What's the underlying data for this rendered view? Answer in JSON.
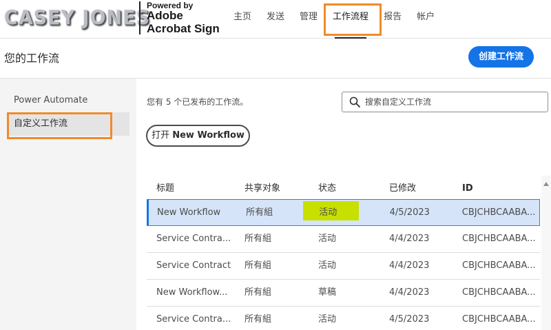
{
  "brand": {
    "logo_text": "CASEY JONES",
    "powered_by": "Powered by",
    "product_line1": "Adobe",
    "product_line2": "Acrobat Sign"
  },
  "nav": {
    "items": [
      {
        "label": "主页"
      },
      {
        "label": "发送"
      },
      {
        "label": "管理"
      },
      {
        "label": "工作流程",
        "active": true
      },
      {
        "label": "报告"
      },
      {
        "label": "帐户"
      }
    ]
  },
  "page": {
    "title": "您的工作流",
    "create_button": "创建工作流"
  },
  "sidebar": {
    "items": [
      {
        "label": "Power Automate"
      },
      {
        "label": "自定义工作流",
        "active": true
      }
    ]
  },
  "main": {
    "count_text": "您有 5 个已发布的工作流。",
    "search_placeholder": "搜索自定义工作流",
    "open_prefix": "打开 ",
    "open_name": "New Workflow"
  },
  "table": {
    "headers": [
      "标题",
      "共享对象",
      "状态",
      "已修改",
      "ID"
    ],
    "rows": [
      {
        "title": "New Workflow",
        "shared": "所有組",
        "status": "活动",
        "modified": "4/5/2023",
        "id": "CBJCHBCAABA...",
        "selected": true
      },
      {
        "title": "Service Contra...",
        "shared": "所有組",
        "status": "活动",
        "modified": "4/4/2023",
        "id": "CBJCHBCAABA..."
      },
      {
        "title": "Service Contract",
        "shared": "所有組",
        "status": "活动",
        "modified": "4/4/2023",
        "id": "CBJCHBCAABA..."
      },
      {
        "title": "New Workflow...",
        "shared": "所有組",
        "status": "草稿",
        "modified": "4/4/2023",
        "id": "CBJCHBCAABA..."
      },
      {
        "title": "Service Contra...",
        "shared": "所有組",
        "status": "活动",
        "modified": "4/5/2023",
        "id": "CBJCHBCAABA..."
      }
    ]
  },
  "colors": {
    "accent": "#1473e6",
    "highlight_box": "#f08a2a",
    "status_highlight": "#c8e000",
    "selected_row": "#d5e4f8"
  }
}
